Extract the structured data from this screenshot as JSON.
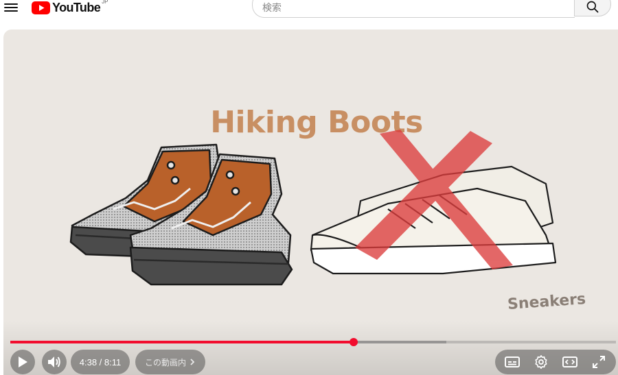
{
  "header": {
    "logo_text": "YouTube",
    "region": "JP",
    "search_placeholder": "検索"
  },
  "video": {
    "title_text": "Hiking Boots",
    "overlay_label": "Sneakers",
    "progress_fraction": 0.567,
    "buffered_fraction": 0.72
  },
  "controls": {
    "time_display": "4:38 / 8:11",
    "chapter_label": "この動画内",
    "play_icon": "play-icon",
    "volume_icon": "volume-icon",
    "subtitles_icon": "subtitles-icon",
    "settings_icon": "gear-icon",
    "theater_icon": "theater-mode-icon",
    "fullscreen_icon": "fullscreen-icon"
  },
  "colors": {
    "accent": "#f20d2e",
    "title": "#c88f63",
    "background": "#ebe7e2"
  }
}
